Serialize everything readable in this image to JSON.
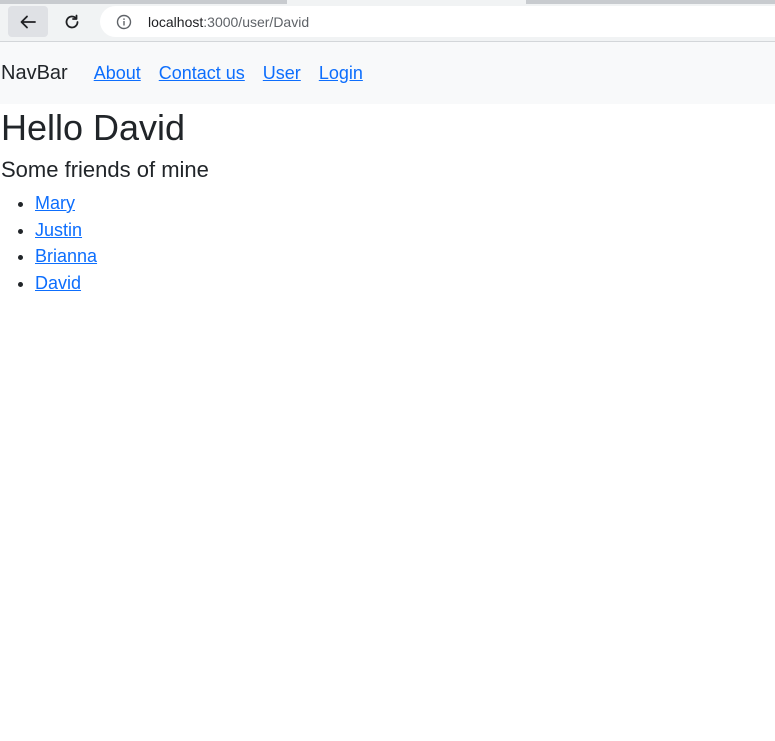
{
  "browser": {
    "url_host": "localhost",
    "url_path": ":3000/user/David"
  },
  "navbar": {
    "brand": "NavBar",
    "links": [
      "About",
      "Contact us",
      "User",
      "Login"
    ]
  },
  "main": {
    "heading": "Hello David",
    "subheading": "Some friends of mine",
    "friends": [
      "Mary",
      "Justin",
      "Brianna",
      "David"
    ]
  },
  "colors": {
    "link": "#0d6efd",
    "navbar_bg": "#f8f9fa",
    "text": "#212529"
  }
}
